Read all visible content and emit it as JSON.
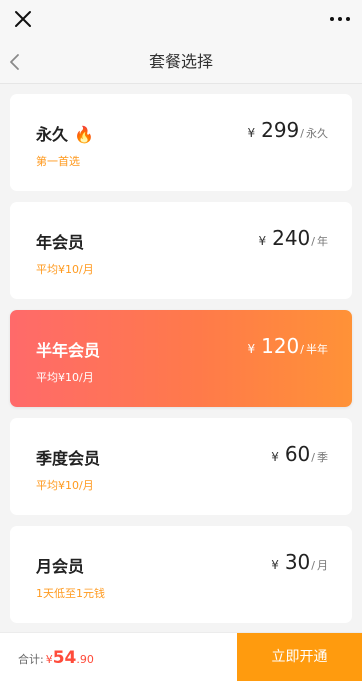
{
  "nav": {
    "title": "套餐选择"
  },
  "plans": [
    {
      "name": "永久",
      "sub": "第一首选",
      "yen": "¥",
      "price": "299",
      "slash": "/",
      "unit": "永久",
      "selected": false,
      "fire": true
    },
    {
      "name": "年会员",
      "sub": "平均¥10/月",
      "yen": "¥",
      "price": "240",
      "slash": "/",
      "unit": "年",
      "selected": false
    },
    {
      "name": "半年会员",
      "sub": "平均¥10/月",
      "yen": "¥",
      "price": "120",
      "slash": "/",
      "unit": "半年",
      "selected": true
    },
    {
      "name": "季度会员",
      "sub": "平均¥10/月",
      "yen": "¥",
      "price": "60",
      "slash": "/",
      "unit": "季",
      "selected": false
    },
    {
      "name": "月会员",
      "sub": "1天低至1元钱",
      "yen": "¥",
      "price": "30",
      "slash": "/",
      "unit": "月",
      "selected": false
    }
  ],
  "footer": {
    "total_label": "合计:",
    "yen": "¥",
    "total_int": "54",
    "total_dec": ".90",
    "buy_label": "立即开通"
  },
  "icons": {
    "close": "close-icon",
    "more": "more-icon",
    "back": "chevron-left-icon",
    "fire": "fire-icon"
  },
  "colors": {
    "accent_orange": "#ff9b0e",
    "sub_text": "#ff9a1f",
    "total_red": "#ff4b3a",
    "active_gradient_start": "#ff6a6a",
    "active_gradient_end": "#ff9237"
  }
}
